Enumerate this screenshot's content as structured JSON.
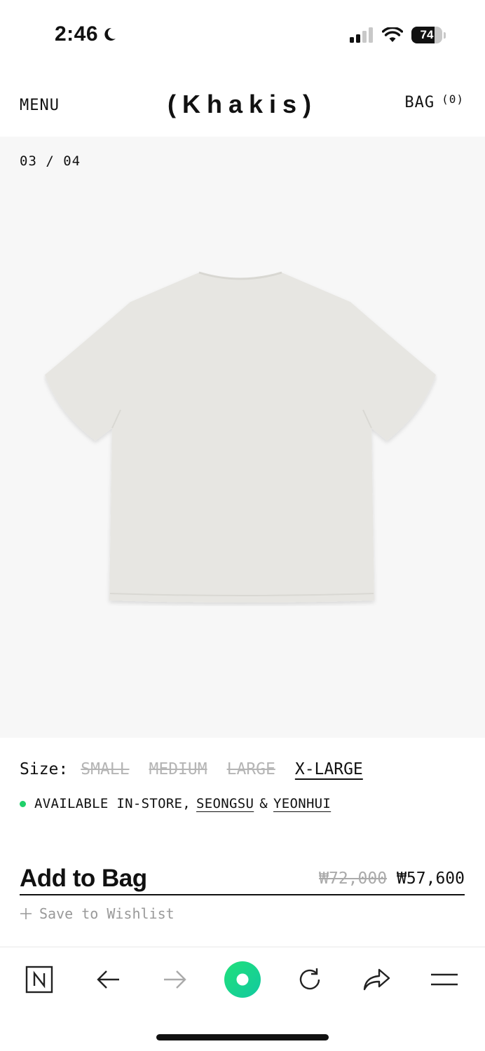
{
  "status": {
    "time": "2:46",
    "battery": "74",
    "battery_level": 0.74
  },
  "header": {
    "menu": "MENU",
    "logo": "(Khakis)",
    "bag": "BAG",
    "bag_count": "(0)"
  },
  "gallery": {
    "counter": "03 / 04"
  },
  "product": {
    "size_label": "Size:",
    "sizes": [
      "SMALL",
      "MEDIUM",
      "LARGE",
      "X-LARGE"
    ],
    "availability": "AVAILABLE IN-STORE,",
    "store1": "SEONGSU",
    "amp": "&",
    "store2": "YEONHUI",
    "add_to_bag": "Add to Bag",
    "price_old": "₩72,000",
    "price_new": "₩57,600",
    "wishlist": "Save to Wishlist"
  },
  "colors": {
    "accent_green": "#1fd06a"
  }
}
